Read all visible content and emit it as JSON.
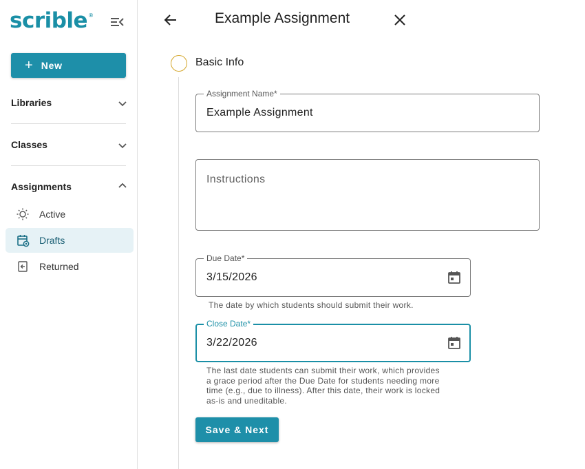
{
  "brand": {
    "logo_text": "scrible",
    "registered": "®"
  },
  "sidebar": {
    "new_button": {
      "icon": "+",
      "label": "New"
    },
    "sections": [
      {
        "title": "Libraries",
        "expanded": false
      },
      {
        "title": "Classes",
        "expanded": false
      },
      {
        "title": "Assignments",
        "expanded": true
      }
    ],
    "assignment_items": [
      {
        "label": "Active",
        "icon": "sun-icon",
        "active": false
      },
      {
        "label": "Drafts",
        "icon": "draft-calendar-icon",
        "active": true
      },
      {
        "label": "Returned",
        "icon": "returned-icon",
        "active": false
      }
    ]
  },
  "header": {
    "title": "Example Assignment"
  },
  "step": {
    "label": "Basic Info"
  },
  "form": {
    "assignment_name": {
      "label": "Assignment Name*",
      "value": "Example Assignment"
    },
    "instructions": {
      "placeholder": "Instructions"
    },
    "due_date": {
      "label": "Due Date*",
      "value": "3/15/2026",
      "helper": "The date by which students should submit their work."
    },
    "close_date": {
      "label": "Close Date*",
      "value": "3/22/2026",
      "helper_lines": [
        "The last date students can submit their work, which provides",
        "a grace period after the Due Date for students needing more",
        "time (e.g., due to illness). After this date, their work is locked",
        "as-is and uneditable."
      ]
    },
    "save_button": "Save & Next"
  },
  "colors": {
    "primary": "#1e8fa9",
    "step_circle": "#d4a62a",
    "active_nav_bg": "#e6f2f6"
  }
}
